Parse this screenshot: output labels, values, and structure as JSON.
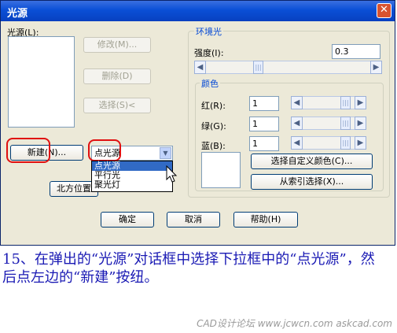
{
  "window": {
    "title": "光源",
    "close_glyph": "✕"
  },
  "light_list_label": "光源(L):",
  "buttons": {
    "modify": "修改(M)...",
    "delete": "删除(D)",
    "select": "选择(S)<",
    "new": "新建(N)...",
    "north": "北方位置",
    "ok": "确定",
    "cancel": "取消",
    "help": "帮助(H)"
  },
  "light_type_select": {
    "value": "点光源",
    "options": [
      "点光源",
      "平行光",
      "聚光灯"
    ]
  },
  "ambient": {
    "group_label": "环境光",
    "intensity_label": "强度(I):",
    "intensity_value": "0.3",
    "color_group_label": "颜色",
    "red_label": "红(R):",
    "red_value": "1",
    "green_label": "绿(G):",
    "green_value": "1",
    "blue_label": "蓝(B):",
    "blue_value": "1",
    "custom_color_button": "选择自定义颜色(C)...",
    "from_index_button": "从索引选择(X)..."
  },
  "icons": {
    "arrow_left": "◀",
    "arrow_right": "▶",
    "thumb": "|||",
    "dropdown": "▼"
  },
  "caption": "15、在弹出的“光源”对话框中选择下拉框中的“点光源”，然后点左边的“新建”按纽。",
  "watermark": "CAD设计论坛 www.jcwcn.com askcad.com"
}
